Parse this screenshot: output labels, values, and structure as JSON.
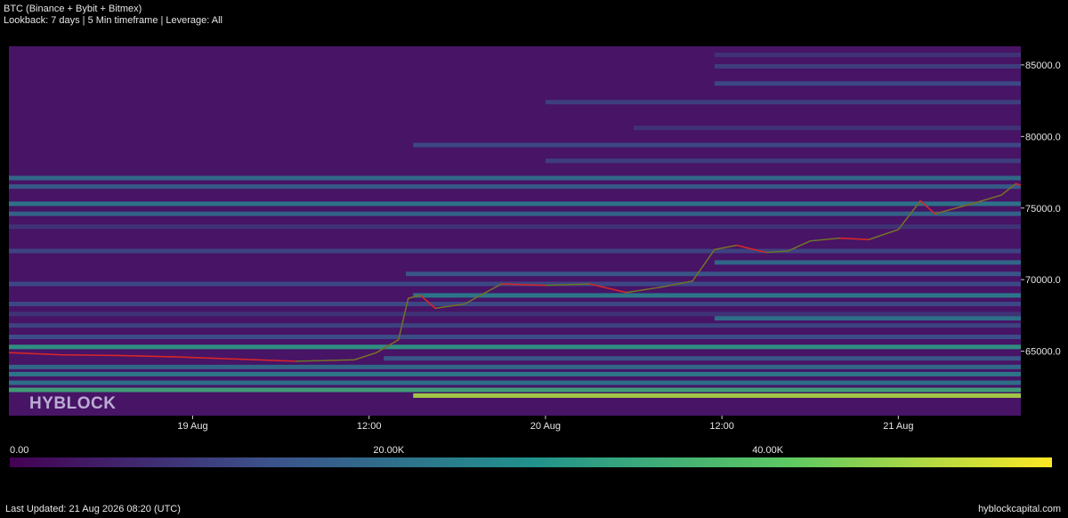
{
  "header": {
    "title": "BTC (Binance + Bybit + Bitmex)",
    "subtitle": "Lookback: 7 days | 5 Min timeframe | Leverage: All"
  },
  "watermark": "HYBLOCK",
  "footer": {
    "last_updated": "Last Updated: 21 Aug 2026 08:20 (UTC)",
    "site": "hyblockcapital.com"
  },
  "colors": {
    "background": "#000000",
    "heatmap_low": "#440154",
    "heatmap_mid": "#21918c",
    "heatmap_high": "#fde725",
    "candle_up": "#2ca02c",
    "candle_down": "#d62728"
  },
  "chart_data": {
    "type": "heatmap",
    "y_axis": {
      "range": [
        60500,
        86300
      ],
      "ticks": [
        65000,
        70000,
        75000,
        80000,
        85000
      ],
      "tick_labels": [
        "65000.0",
        "70000.0",
        "75000.0",
        "80000.0",
        "85000.0"
      ],
      "side": "right"
    },
    "x_axis": {
      "range": [
        "2026-08-18T11:30",
        "2026-08-21T08:20"
      ],
      "ticks": [
        "2026-08-19T00:00",
        "2026-08-19T12:00",
        "2026-08-20T00:00",
        "2026-08-20T12:00",
        "2026-08-21T00:00"
      ],
      "tick_labels": [
        "19 Aug",
        "12:00",
        "20 Aug",
        "12:00",
        "21 Aug"
      ]
    },
    "colorbar": {
      "min": 0,
      "max": 55000,
      "ticks": [
        0,
        20000,
        40000
      ],
      "tick_labels": [
        "0.00",
        "20.00K",
        "40.00K"
      ],
      "colormap": "viridis"
    },
    "price_series": [
      {
        "t": "2026-08-18T11:30",
        "price": 64900
      },
      {
        "t": "2026-08-18T15:00",
        "price": 64750
      },
      {
        "t": "2026-08-18T19:00",
        "price": 64700
      },
      {
        "t": "2026-08-18T23:00",
        "price": 64600
      },
      {
        "t": "2026-08-19T03:00",
        "price": 64450
      },
      {
        "t": "2026-08-19T07:00",
        "price": 64300
      },
      {
        "t": "2026-08-19T11:00",
        "price": 64400
      },
      {
        "t": "2026-08-19T12:30",
        "price": 64900
      },
      {
        "t": "2026-08-19T14:00",
        "price": 65800
      },
      {
        "t": "2026-08-19T14:40",
        "price": 68700
      },
      {
        "t": "2026-08-19T15:30",
        "price": 68900
      },
      {
        "t": "2026-08-19T16:30",
        "price": 68000
      },
      {
        "t": "2026-08-19T18:30",
        "price": 68300
      },
      {
        "t": "2026-08-19T21:00",
        "price": 69700
      },
      {
        "t": "2026-08-20T00:00",
        "price": 69600
      },
      {
        "t": "2026-08-20T03:00",
        "price": 69700
      },
      {
        "t": "2026-08-20T05:30",
        "price": 69100
      },
      {
        "t": "2026-08-20T08:00",
        "price": 69500
      },
      {
        "t": "2026-08-20T10:00",
        "price": 69900
      },
      {
        "t": "2026-08-20T11:30",
        "price": 72100
      },
      {
        "t": "2026-08-20T13:00",
        "price": 72400
      },
      {
        "t": "2026-08-20T15:00",
        "price": 71900
      },
      {
        "t": "2026-08-20T16:30",
        "price": 72000
      },
      {
        "t": "2026-08-20T18:00",
        "price": 72700
      },
      {
        "t": "2026-08-20T20:00",
        "price": 72900
      },
      {
        "t": "2026-08-20T22:00",
        "price": 72800
      },
      {
        "t": "2026-08-21T00:00",
        "price": 73500
      },
      {
        "t": "2026-08-21T01:30",
        "price": 75500
      },
      {
        "t": "2026-08-21T02:30",
        "price": 74600
      },
      {
        "t": "2026-08-21T05:00",
        "price": 75300
      },
      {
        "t": "2026-08-21T07:00",
        "price": 75900
      },
      {
        "t": "2026-08-21T08:00",
        "price": 76700
      },
      {
        "t": "2026-08-21T08:20",
        "price": 76600
      }
    ],
    "liquidation_bands": [
      {
        "price": 61900,
        "intensity": 48000,
        "start": "2026-08-19T15:00"
      },
      {
        "price": 62300,
        "intensity": 34000,
        "start": "2026-08-18T11:30"
      },
      {
        "price": 62800,
        "intensity": 22000,
        "start": "2026-08-18T11:30"
      },
      {
        "price": 63400,
        "intensity": 24000,
        "start": "2026-08-18T11:30"
      },
      {
        "price": 63900,
        "intensity": 20000,
        "start": "2026-08-18T11:30"
      },
      {
        "price": 64500,
        "intensity": 16000,
        "start": "2026-08-19T13:00"
      },
      {
        "price": 65300,
        "intensity": 30000,
        "start": "2026-08-18T11:30"
      },
      {
        "price": 66000,
        "intensity": 14000,
        "start": "2026-08-18T11:30"
      },
      {
        "price": 66800,
        "intensity": 12000,
        "start": "2026-08-18T11:30"
      },
      {
        "price": 67300,
        "intensity": 22000,
        "start": "2026-08-20T11:30"
      },
      {
        "price": 67600,
        "intensity": 9000,
        "start": "2026-08-18T11:30"
      },
      {
        "price": 68300,
        "intensity": 13000,
        "start": "2026-08-18T11:30"
      },
      {
        "price": 68900,
        "intensity": 24000,
        "start": "2026-08-19T15:00"
      },
      {
        "price": 69700,
        "intensity": 13000,
        "start": "2026-08-18T11:30"
      },
      {
        "price": 70400,
        "intensity": 16000,
        "start": "2026-08-19T14:30"
      },
      {
        "price": 71200,
        "intensity": 20000,
        "start": "2026-08-20T11:30"
      },
      {
        "price": 72000,
        "intensity": 12000,
        "start": "2026-08-18T11:30"
      },
      {
        "price": 73700,
        "intensity": 9000,
        "start": "2026-08-18T11:30"
      },
      {
        "price": 74600,
        "intensity": 19000,
        "start": "2026-08-18T11:30"
      },
      {
        "price": 75300,
        "intensity": 23000,
        "start": "2026-08-18T11:30"
      },
      {
        "price": 76500,
        "intensity": 17000,
        "start": "2026-08-18T11:30"
      },
      {
        "price": 77100,
        "intensity": 20000,
        "start": "2026-08-18T11:30"
      },
      {
        "price": 78300,
        "intensity": 11000,
        "start": "2026-08-20T00:00"
      },
      {
        "price": 79400,
        "intensity": 13000,
        "start": "2026-08-19T15:00"
      },
      {
        "price": 80600,
        "intensity": 9000,
        "start": "2026-08-20T06:00"
      },
      {
        "price": 82400,
        "intensity": 11000,
        "start": "2026-08-20T00:00"
      },
      {
        "price": 83700,
        "intensity": 13000,
        "start": "2026-08-20T11:30"
      },
      {
        "price": 84900,
        "intensity": 11000,
        "start": "2026-08-20T11:30"
      },
      {
        "price": 85700,
        "intensity": 9000,
        "start": "2026-08-20T11:30"
      }
    ]
  }
}
